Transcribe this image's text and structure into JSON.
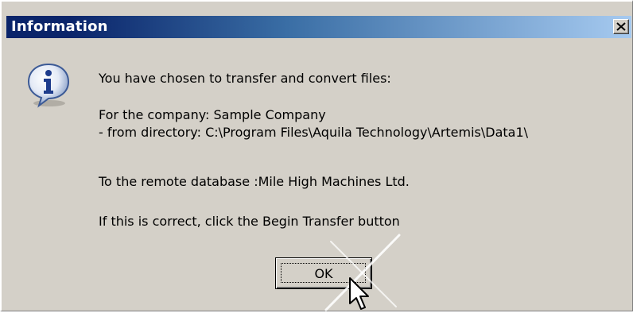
{
  "dialog": {
    "title": "Information",
    "close_icon": "close-icon",
    "icon": "info-icon",
    "messages": [
      "You have chosen to transfer and convert files:",
      "For the company: Sample Company",
      "- from directory: C:\\Program Files\\Aquila Technology\\Artemis\\Data1\\",
      "To the remote database :Mile High Machines Ltd.",
      "If this is correct, click the Begin Transfer button"
    ],
    "ok_label": "OK"
  },
  "colors": {
    "title_gradient_start": "#0a246a",
    "title_gradient_end": "#a6caf0",
    "dialog_background": "#d4d0c8"
  }
}
